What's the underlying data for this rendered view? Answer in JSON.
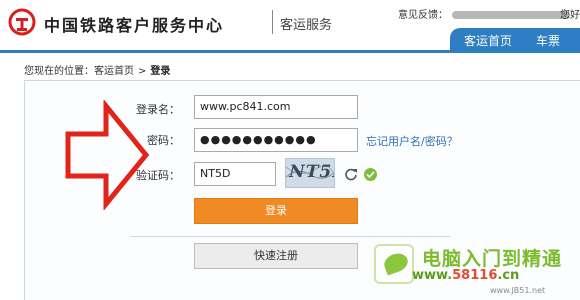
{
  "header": {
    "site_name": "中国铁路客户服务中心",
    "site_sub": "客运服务",
    "feedback_label": "意见反馈：",
    "greeting": "您好"
  },
  "nav": {
    "items": [
      {
        "label": "客运首页"
      },
      {
        "label": "车票"
      }
    ]
  },
  "breadcrumb": {
    "prefix": "您现在的位置：",
    "home": "客运首页",
    "separator": ">",
    "current": "登录"
  },
  "form": {
    "username_label": "登录名：",
    "username_value": "www.pc841.com",
    "password_label": "密码：",
    "password_value": "●●●●●●●●●●●",
    "captcha_label": "验证码：",
    "captcha_value": "NT5D",
    "captcha_image_text": "NT5D",
    "forgot_link": "忘记用户名/密码？",
    "login_button": "登录",
    "register_button": "快速注册"
  },
  "watermark": {
    "title": "电脑入门到精通",
    "url_prefix": "www.",
    "url_accent": "58116",
    "url_suffix": ".cn",
    "url2": "www.JB51.net"
  },
  "icons": {
    "logo": "railway-logo-icon",
    "arrow": "red-arrow-icon",
    "refresh": "refresh-icon",
    "check": "check-icon"
  },
  "colors": {
    "nav_blue": "#2f7ec3",
    "login_orange": "#f08a24",
    "arrow_red": "#e2231a",
    "logo_red": "#d6201d",
    "check_green": "#7cbd3a"
  }
}
